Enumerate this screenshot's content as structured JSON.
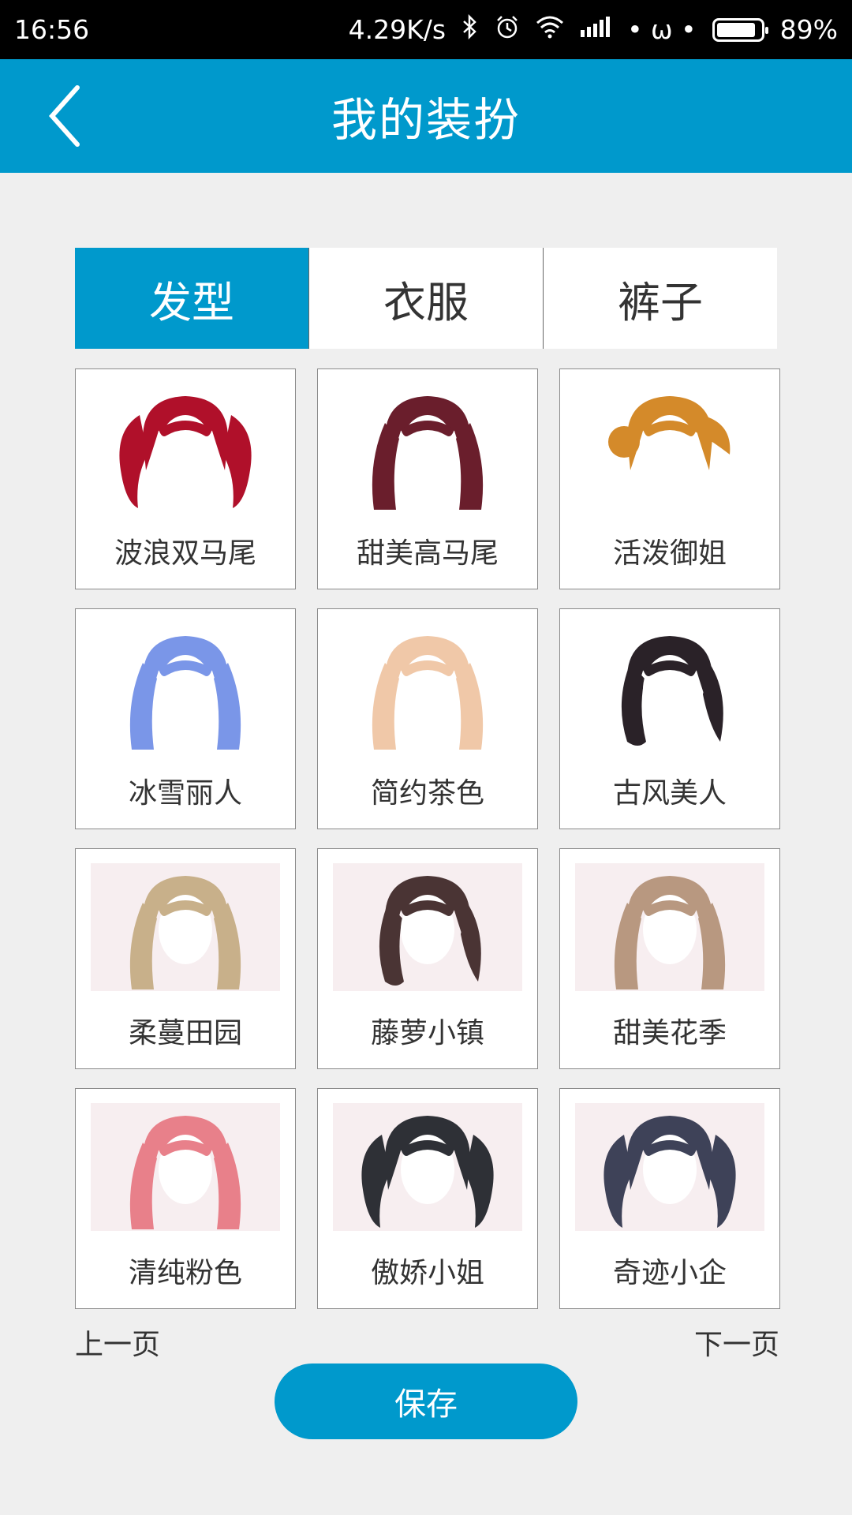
{
  "status_bar": {
    "time": "16:56",
    "speed": "4.29K/s",
    "icons": [
      "bluetooth-icon",
      "alarm-icon",
      "wifi-icon",
      "signal-icon"
    ],
    "misc": "• ω •",
    "battery": "89%",
    "battery_level": 0.89
  },
  "header": {
    "title": "我的装扮",
    "back_icon": "chevron-left-icon",
    "color": "#0099cc"
  },
  "tabs": [
    {
      "label": "发型",
      "active": true
    },
    {
      "label": "衣服",
      "active": false
    },
    {
      "label": "裤子",
      "active": false
    }
  ],
  "items": [
    {
      "label": "波浪双马尾",
      "hair_color": "#b0102a",
      "style": "twin"
    },
    {
      "label": "甜美高马尾",
      "hair_color": "#6a1e2c",
      "style": "long"
    },
    {
      "label": "活泼御姐",
      "hair_color": "#d48a2a",
      "style": "bun"
    },
    {
      "label": "冰雪丽人",
      "hair_color": "#7a96e8",
      "style": "long"
    },
    {
      "label": "简约茶色",
      "hair_color": "#f0c8a8",
      "style": "long"
    },
    {
      "label": "古风美人",
      "hair_color": "#2a2228",
      "style": "side"
    },
    {
      "label": "柔蔓田园",
      "hair_color": "#c8b08a",
      "style": "long"
    },
    {
      "label": "藤萝小镇",
      "hair_color": "#4a3434",
      "style": "side"
    },
    {
      "label": "甜美花季",
      "hair_color": "#b89880",
      "style": "long"
    },
    {
      "label": "清纯粉色",
      "hair_color": "#e8808a",
      "style": "long"
    },
    {
      "label": "傲娇小姐",
      "hair_color": "#2e3036",
      "style": "twin"
    },
    {
      "label": "奇迹小企",
      "hair_color": "#3e4258",
      "style": "twin"
    }
  ],
  "pagination": {
    "prev": "上一页",
    "next": "下一页"
  },
  "save_label": "保存"
}
